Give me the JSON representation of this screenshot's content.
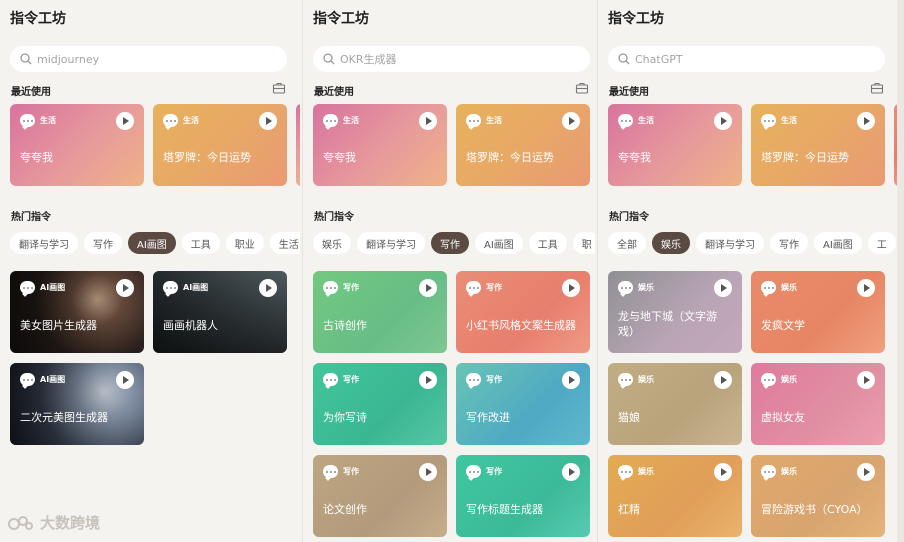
{
  "panels": [
    {
      "title": "指令工坊",
      "search_placeholder": "midjourney",
      "recent_label": "最近使用",
      "recent": [
        {
          "category": "生活",
          "name": "夸夸我"
        },
        {
          "category": "生活",
          "name": "塔罗牌：今日运势"
        }
      ],
      "hot_label": "热门指令",
      "tabs": [
        "翻译与学习",
        "写作",
        "AI画图",
        "工具",
        "职业",
        "生活"
      ],
      "active_tab": 2,
      "cards": [
        {
          "category": "AI画图",
          "name": "美女图片生成器"
        },
        {
          "category": "AI画图",
          "name": "画画机器人"
        },
        {
          "category": "AI画图",
          "name": "二次元美图生成器"
        }
      ]
    },
    {
      "title": "指令工坊",
      "search_placeholder": "OKR生成器",
      "recent_label": "最近使用",
      "recent": [
        {
          "category": "生活",
          "name": "夸夸我"
        },
        {
          "category": "生活",
          "name": "塔罗牌：今日运势"
        }
      ],
      "hot_label": "热门指令",
      "tabs": [
        "娱乐",
        "翻译与学习",
        "写作",
        "AI画图",
        "工具",
        "职"
      ],
      "active_tab": 2,
      "cards": [
        {
          "category": "写作",
          "name": "古诗创作"
        },
        {
          "category": "写作",
          "name": "小红书风格文案生成器"
        },
        {
          "category": "写作",
          "name": "为你写诗"
        },
        {
          "category": "写作",
          "name": "写作改进"
        },
        {
          "category": "写作",
          "name": "论文创作"
        },
        {
          "category": "写作",
          "name": "写作标题生成器"
        }
      ]
    },
    {
      "title": "指令工坊",
      "search_placeholder": "ChatGPT",
      "recent_label": "最近使用",
      "recent": [
        {
          "category": "生活",
          "name": "夸夸我"
        },
        {
          "category": "生活",
          "name": "塔罗牌：今日运势"
        }
      ],
      "hot_label": "热门指令",
      "tabs": [
        "全部",
        "娱乐",
        "翻译与学习",
        "写作",
        "AI画图",
        "工"
      ],
      "active_tab": 1,
      "cards": [
        {
          "category": "娱乐",
          "name": "龙与地下城（文字游戏）"
        },
        {
          "category": "娱乐",
          "name": "发疯文学"
        },
        {
          "category": "娱乐",
          "name": "猫娘"
        },
        {
          "category": "娱乐",
          "name": "虚拟女友"
        },
        {
          "category": "娱乐",
          "name": "杠精"
        },
        {
          "category": "娱乐",
          "name": "冒险游戏书（CYOA）"
        }
      ]
    }
  ],
  "watermark": "大数跨境",
  "colors": {
    "active_tab": "#5b4a42",
    "background": "#f5f3f0"
  }
}
